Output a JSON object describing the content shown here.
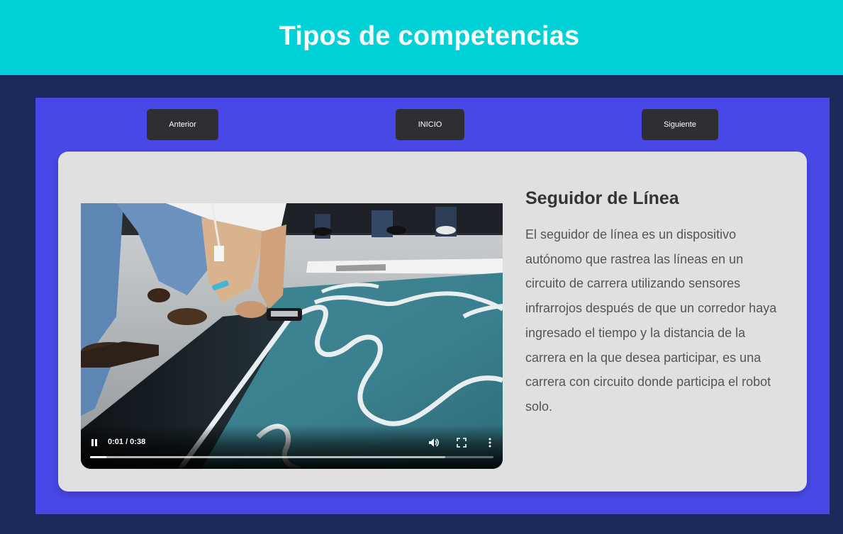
{
  "header": {
    "title": "Tipos de competencias"
  },
  "nav": {
    "prev_label": "Anterior",
    "home_label": "INICIO",
    "next_label": "Siguiente"
  },
  "card": {
    "title": "Seguidor de Línea",
    "description": "El seguidor de línea es un dispositivo autónomo que rastrea las líneas en un circuito de carrera utilizando sensores infrarrojos después de que un corredor haya ingresado el tiempo y la distancia de la carrera en la que desea participar, es una carrera con circuito donde participa el robot solo."
  },
  "video": {
    "time_display": "0:01 / 0:38",
    "played_fraction": 0.04,
    "buffered_fraction": 0.88
  },
  "icons": {
    "play_pause": "pause-icon",
    "volume": "volume-icon",
    "fullscreen": "fullscreen-icon",
    "more": "more-vertical-icon"
  },
  "colors": {
    "header_bg": "#00d1d6",
    "page_bg": "#1b2a5c",
    "panel_bg": "#4848e6",
    "card_bg": "#e0e0e0",
    "button_bg": "#2f2f33"
  }
}
